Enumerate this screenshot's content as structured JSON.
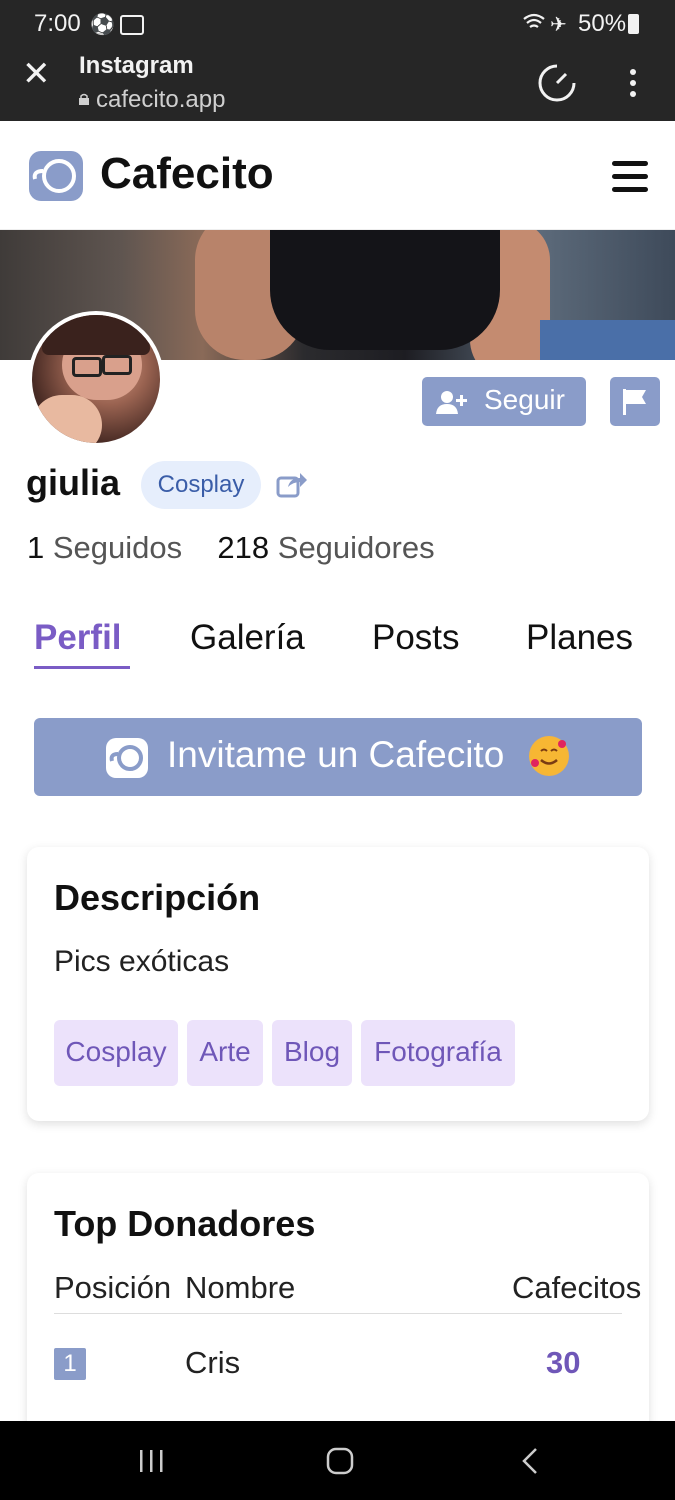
{
  "status_bar": {
    "time": "7:00",
    "battery": "50%"
  },
  "browser": {
    "title": "Instagram",
    "url": "cafecito.app"
  },
  "header": {
    "brand": "Cafecito"
  },
  "profile": {
    "username": "giulia",
    "category": "Cosplay",
    "following_count": "1",
    "following_label": "Seguidos",
    "followers_count": "218",
    "followers_label": "Seguidores",
    "follow_label": "Seguir"
  },
  "tabs": [
    "Perfil",
    "Galería",
    "Posts",
    "Planes"
  ],
  "cafecito_button": {
    "label": "Invitame un Cafecito"
  },
  "description": {
    "title": "Descripción",
    "text": "Pics exóticas",
    "tags": [
      "Cosplay",
      "Arte",
      "Blog",
      "Fotografía"
    ]
  },
  "donors": {
    "title": "Top Donadores",
    "headers": [
      "Posición",
      "Nombre",
      "Cafecitos"
    ],
    "rows": [
      {
        "position": "1",
        "name": "Cris",
        "count": "30"
      }
    ]
  },
  "colors": {
    "accent": "#8a9cc9",
    "purple": "#7a5cc5",
    "tag_bg": "#ece2fb"
  },
  "icons": [
    "soccer-ball-icon",
    "screen-recorder-icon",
    "wifi-icon",
    "airplane-icon",
    "battery-icon",
    "close-icon",
    "lock-icon",
    "speedometer-icon",
    "more-vert-icon",
    "hamburger-menu-icon",
    "add-user-icon",
    "flag-icon",
    "share-icon",
    "cafecito-cup-icon",
    "smiling-hearts-emoji-icon"
  ]
}
